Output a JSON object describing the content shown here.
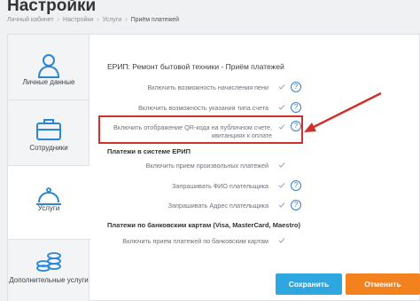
{
  "header": {
    "title": "Настройки",
    "breadcrumb": [
      "Личный кабинет",
      "Настройки",
      "Услуги",
      "Приём платежей"
    ]
  },
  "sidebar": {
    "items": [
      {
        "label": "Личные данные",
        "icon": "user-icon",
        "active": false
      },
      {
        "label": "Сотрудники",
        "icon": "briefcase-icon",
        "active": false
      },
      {
        "label": "Услуги",
        "icon": "cloche-icon",
        "active": true
      },
      {
        "label": "Дополнительные услуги",
        "icon": "coins-icon",
        "active": false
      }
    ]
  },
  "main": {
    "section_title": "ЕРИП: Ремонт бытовой техники - Приём платежей",
    "options": [
      {
        "label": "Включить возможность начисления пени"
      },
      {
        "label": "Включить возможность указания типа счета"
      },
      {
        "label": "Включить отображение QR-кода на публичном счете, квитанциях к оплате"
      }
    ],
    "erip_subtitle": "Платежи в системе ЕРИП",
    "erip_options": [
      {
        "label": "Включить прием произвольных платежей"
      },
      {
        "label": "Запрашивать ФИО плательщика"
      },
      {
        "label": "Запрашивать Адрес плательщика"
      }
    ],
    "card_subtitle": "Платежи по банковским картам (Visa, MasterCard, Maestro)",
    "card_options": [
      {
        "label": "Включить прием платежей по банковским картам"
      }
    ]
  },
  "footer": {
    "save_label": "Сохранить",
    "cancel_label": "Отменить"
  },
  "colors": {
    "save": "#2ea7e0",
    "cancel": "#f3811e",
    "highlight": "#d0312d",
    "help": "#3a7fd4"
  }
}
